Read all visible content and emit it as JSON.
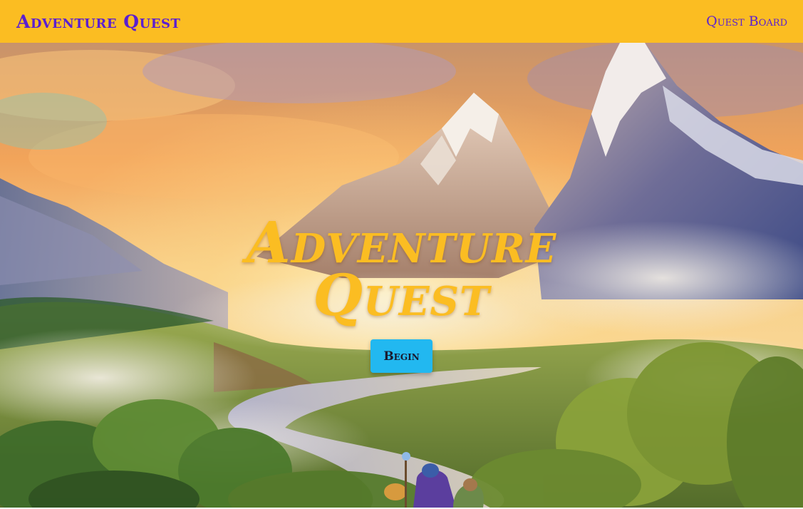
{
  "navbar": {
    "brand": "Adventure Quest",
    "link": "Quest Board"
  },
  "hero": {
    "title_line1": "Adventure",
    "title_line2": "Quest",
    "button_label": "Begin"
  },
  "colors": {
    "navbar_bg": "#fbbd22",
    "brand_text": "#5b1fd0",
    "title_text": "#fbbd22",
    "button_bg": "#22b8f0"
  }
}
